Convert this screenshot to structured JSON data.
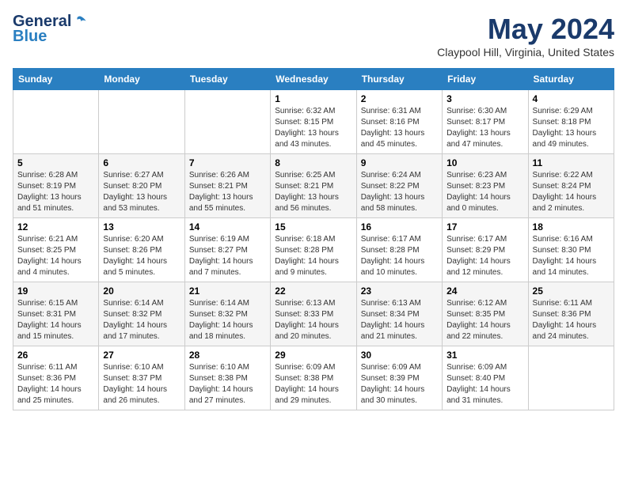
{
  "header": {
    "logo_general": "General",
    "logo_blue": "Blue",
    "month_title": "May 2024",
    "location": "Claypool Hill, Virginia, United States"
  },
  "days_of_week": [
    "Sunday",
    "Monday",
    "Tuesday",
    "Wednesday",
    "Thursday",
    "Friday",
    "Saturday"
  ],
  "weeks": [
    [
      {
        "day": "",
        "info": ""
      },
      {
        "day": "",
        "info": ""
      },
      {
        "day": "",
        "info": ""
      },
      {
        "day": "1",
        "info": "Sunrise: 6:32 AM\nSunset: 8:15 PM\nDaylight: 13 hours\nand 43 minutes."
      },
      {
        "day": "2",
        "info": "Sunrise: 6:31 AM\nSunset: 8:16 PM\nDaylight: 13 hours\nand 45 minutes."
      },
      {
        "day": "3",
        "info": "Sunrise: 6:30 AM\nSunset: 8:17 PM\nDaylight: 13 hours\nand 47 minutes."
      },
      {
        "day": "4",
        "info": "Sunrise: 6:29 AM\nSunset: 8:18 PM\nDaylight: 13 hours\nand 49 minutes."
      }
    ],
    [
      {
        "day": "5",
        "info": "Sunrise: 6:28 AM\nSunset: 8:19 PM\nDaylight: 13 hours\nand 51 minutes."
      },
      {
        "day": "6",
        "info": "Sunrise: 6:27 AM\nSunset: 8:20 PM\nDaylight: 13 hours\nand 53 minutes."
      },
      {
        "day": "7",
        "info": "Sunrise: 6:26 AM\nSunset: 8:21 PM\nDaylight: 13 hours\nand 55 minutes."
      },
      {
        "day": "8",
        "info": "Sunrise: 6:25 AM\nSunset: 8:21 PM\nDaylight: 13 hours\nand 56 minutes."
      },
      {
        "day": "9",
        "info": "Sunrise: 6:24 AM\nSunset: 8:22 PM\nDaylight: 13 hours\nand 58 minutes."
      },
      {
        "day": "10",
        "info": "Sunrise: 6:23 AM\nSunset: 8:23 PM\nDaylight: 14 hours\nand 0 minutes."
      },
      {
        "day": "11",
        "info": "Sunrise: 6:22 AM\nSunset: 8:24 PM\nDaylight: 14 hours\nand 2 minutes."
      }
    ],
    [
      {
        "day": "12",
        "info": "Sunrise: 6:21 AM\nSunset: 8:25 PM\nDaylight: 14 hours\nand 4 minutes."
      },
      {
        "day": "13",
        "info": "Sunrise: 6:20 AM\nSunset: 8:26 PM\nDaylight: 14 hours\nand 5 minutes."
      },
      {
        "day": "14",
        "info": "Sunrise: 6:19 AM\nSunset: 8:27 PM\nDaylight: 14 hours\nand 7 minutes."
      },
      {
        "day": "15",
        "info": "Sunrise: 6:18 AM\nSunset: 8:28 PM\nDaylight: 14 hours\nand 9 minutes."
      },
      {
        "day": "16",
        "info": "Sunrise: 6:17 AM\nSunset: 8:28 PM\nDaylight: 14 hours\nand 10 minutes."
      },
      {
        "day": "17",
        "info": "Sunrise: 6:17 AM\nSunset: 8:29 PM\nDaylight: 14 hours\nand 12 minutes."
      },
      {
        "day": "18",
        "info": "Sunrise: 6:16 AM\nSunset: 8:30 PM\nDaylight: 14 hours\nand 14 minutes."
      }
    ],
    [
      {
        "day": "19",
        "info": "Sunrise: 6:15 AM\nSunset: 8:31 PM\nDaylight: 14 hours\nand 15 minutes."
      },
      {
        "day": "20",
        "info": "Sunrise: 6:14 AM\nSunset: 8:32 PM\nDaylight: 14 hours\nand 17 minutes."
      },
      {
        "day": "21",
        "info": "Sunrise: 6:14 AM\nSunset: 8:32 PM\nDaylight: 14 hours\nand 18 minutes."
      },
      {
        "day": "22",
        "info": "Sunrise: 6:13 AM\nSunset: 8:33 PM\nDaylight: 14 hours\nand 20 minutes."
      },
      {
        "day": "23",
        "info": "Sunrise: 6:13 AM\nSunset: 8:34 PM\nDaylight: 14 hours\nand 21 minutes."
      },
      {
        "day": "24",
        "info": "Sunrise: 6:12 AM\nSunset: 8:35 PM\nDaylight: 14 hours\nand 22 minutes."
      },
      {
        "day": "25",
        "info": "Sunrise: 6:11 AM\nSunset: 8:36 PM\nDaylight: 14 hours\nand 24 minutes."
      }
    ],
    [
      {
        "day": "26",
        "info": "Sunrise: 6:11 AM\nSunset: 8:36 PM\nDaylight: 14 hours\nand 25 minutes."
      },
      {
        "day": "27",
        "info": "Sunrise: 6:10 AM\nSunset: 8:37 PM\nDaylight: 14 hours\nand 26 minutes."
      },
      {
        "day": "28",
        "info": "Sunrise: 6:10 AM\nSunset: 8:38 PM\nDaylight: 14 hours\nand 27 minutes."
      },
      {
        "day": "29",
        "info": "Sunrise: 6:09 AM\nSunset: 8:38 PM\nDaylight: 14 hours\nand 29 minutes."
      },
      {
        "day": "30",
        "info": "Sunrise: 6:09 AM\nSunset: 8:39 PM\nDaylight: 14 hours\nand 30 minutes."
      },
      {
        "day": "31",
        "info": "Sunrise: 6:09 AM\nSunset: 8:40 PM\nDaylight: 14 hours\nand 31 minutes."
      },
      {
        "day": "",
        "info": ""
      }
    ]
  ]
}
